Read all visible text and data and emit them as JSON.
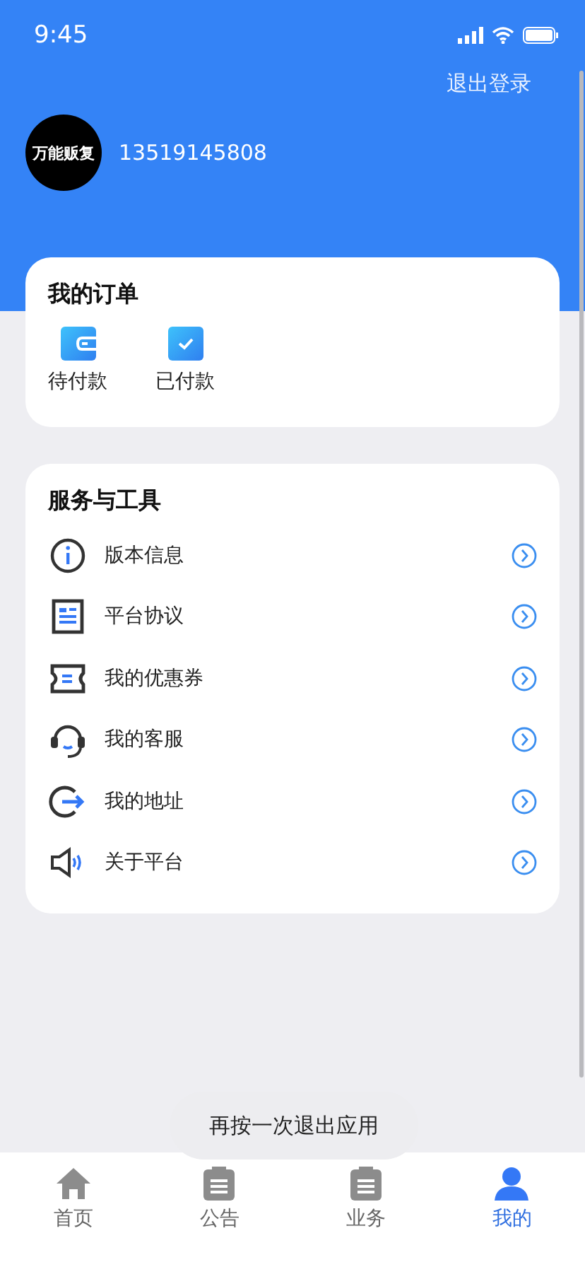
{
  "status_bar": {
    "time": "9:45"
  },
  "header": {
    "logout": "退出登录",
    "avatar_logo": "万能贩复",
    "phone": "13519145808"
  },
  "orders": {
    "title": "我的订单",
    "items": [
      {
        "label": "待付款"
      },
      {
        "label": "已付款"
      }
    ]
  },
  "services": {
    "title": "服务与工具",
    "items": [
      {
        "label": "版本信息"
      },
      {
        "label": "平台协议"
      },
      {
        "label": "我的优惠券"
      },
      {
        "label": "我的客服"
      },
      {
        "label": "我的地址"
      },
      {
        "label": "关于平台"
      }
    ]
  },
  "toast": "再按一次退出应用",
  "tab_bar": [
    {
      "label": "首页",
      "selected": false
    },
    {
      "label": "公告",
      "selected": false
    },
    {
      "label": "业务",
      "selected": false
    },
    {
      "label": "我的",
      "selected": true
    }
  ]
}
